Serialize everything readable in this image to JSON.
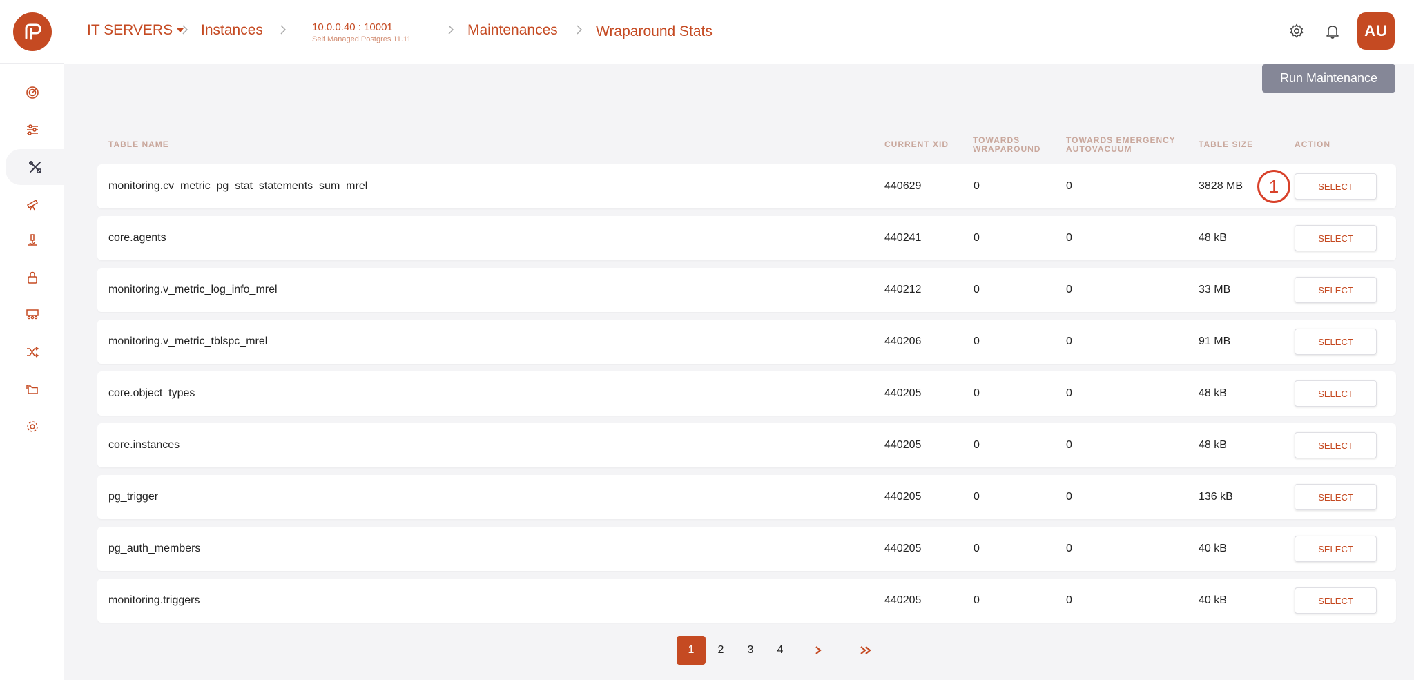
{
  "breadcrumb": {
    "group": "IT SERVERS",
    "instances": "Instances",
    "instance_ip": "10.0.0.40 : 10001",
    "instance_desc": "Self Managed Postgres 11.11",
    "maintenances": "Maintenances",
    "current": "Wraparound Stats"
  },
  "user": {
    "initials": "AU"
  },
  "actions": {
    "run_maintenance": "Run Maintenance"
  },
  "table": {
    "headers": {
      "name": "TABLE NAME",
      "xid": "CURRENT XID",
      "wraparound_1": "TOWARDS",
      "wraparound_2": "WRAPAROUND",
      "emergency_1": "TOWARDS EMERGENCY",
      "emergency_2": "AUTOVACUUM",
      "size": "TABLE SIZE",
      "action": "ACTION"
    },
    "select_label": "SELECT",
    "rows": [
      {
        "name": "monitoring.cv_metric_pg_stat_statements_sum_mrel",
        "xid": "440629",
        "wrap": "0",
        "emerg": "0",
        "size": "3828 MB"
      },
      {
        "name": "core.agents",
        "xid": "440241",
        "wrap": "0",
        "emerg": "0",
        "size": "48 kB"
      },
      {
        "name": "monitoring.v_metric_log_info_mrel",
        "xid": "440212",
        "wrap": "0",
        "emerg": "0",
        "size": "33 MB"
      },
      {
        "name": "monitoring.v_metric_tblspc_mrel",
        "xid": "440206",
        "wrap": "0",
        "emerg": "0",
        "size": "91 MB"
      },
      {
        "name": "core.object_types",
        "xid": "440205",
        "wrap": "0",
        "emerg": "0",
        "size": "48 kB"
      },
      {
        "name": "core.instances",
        "xid": "440205",
        "wrap": "0",
        "emerg": "0",
        "size": "48 kB"
      },
      {
        "name": "pg_trigger",
        "xid": "440205",
        "wrap": "0",
        "emerg": "0",
        "size": "136 kB"
      },
      {
        "name": "pg_auth_members",
        "xid": "440205",
        "wrap": "0",
        "emerg": "0",
        "size": "40 kB"
      },
      {
        "name": "monitoring.triggers",
        "xid": "440205",
        "wrap": "0",
        "emerg": "0",
        "size": "40 kB"
      }
    ]
  },
  "annotation": {
    "marker": "1"
  },
  "pagination": {
    "pages": [
      "1",
      "2",
      "3",
      "4"
    ],
    "current": "1"
  },
  "colors": {
    "accent": "#c54a22",
    "button_gray": "#858797",
    "header_text": "#c9a79c"
  }
}
